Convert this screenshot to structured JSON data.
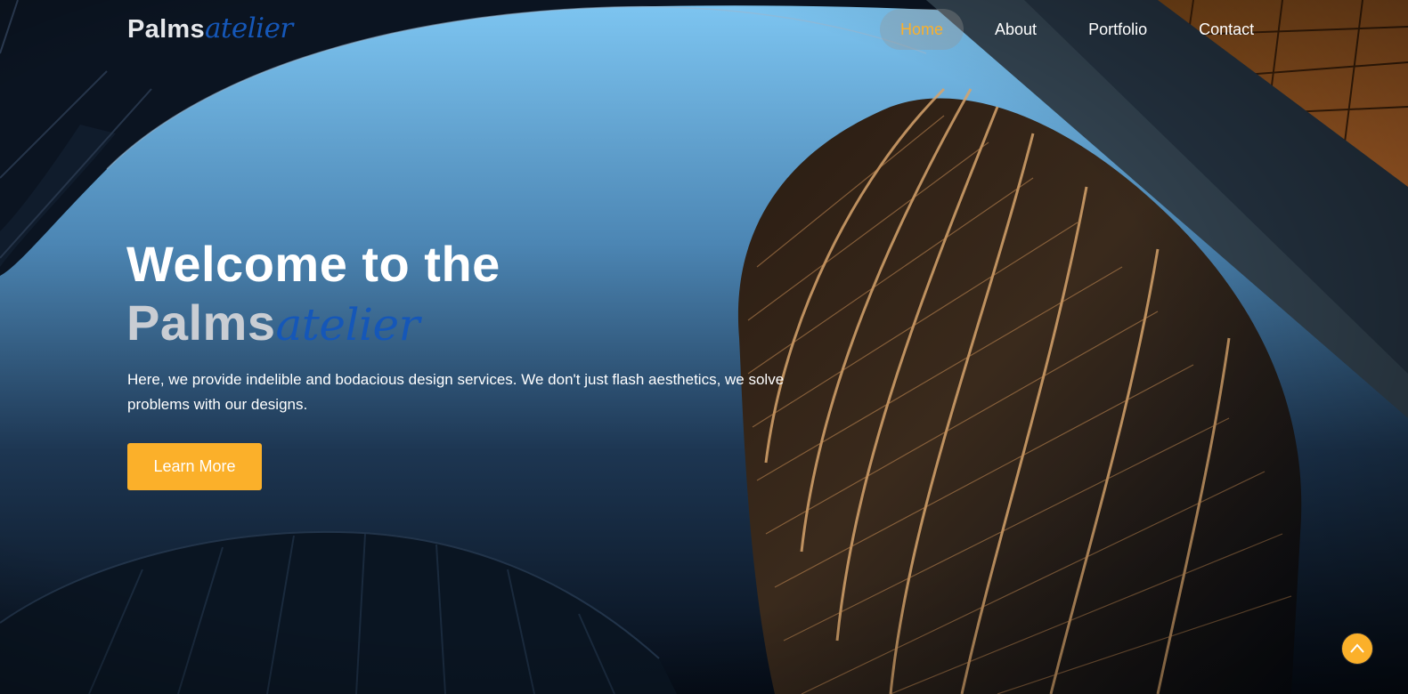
{
  "brand": {
    "main": "Palms",
    "script": "atelier"
  },
  "nav": {
    "items": [
      {
        "label": "Home",
        "active": true
      },
      {
        "label": "About",
        "active": false
      },
      {
        "label": "Portfolio",
        "active": false
      },
      {
        "label": "Contact",
        "active": false
      }
    ]
  },
  "hero": {
    "heading_line1": "Welcome to the",
    "heading_brand_main": "Palms",
    "heading_brand_script": "atelier",
    "lead": "Here, we provide indelible and bodacious design services. We don't just flash aesthetics, we solve problems with our designs.",
    "cta_label": "Learn More",
    "background": "architecture-photo"
  },
  "back_to_top": {
    "icon": "chevron-up-icon"
  },
  "colors": {
    "accent": "#fbb02a",
    "script_blue": "#1557b8",
    "text": "#ffffff",
    "brand_gray": "#c9cdd3"
  }
}
